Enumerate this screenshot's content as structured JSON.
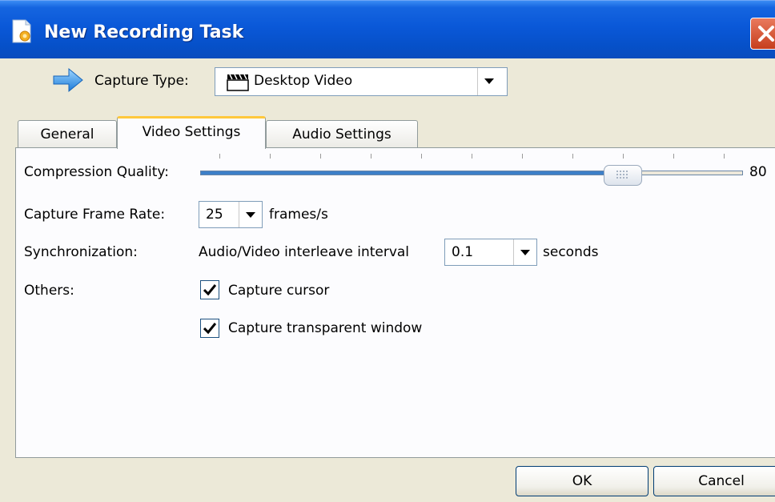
{
  "window": {
    "title": "New Recording Task",
    "app_icon": "document-new-icon",
    "close_icon": "close-icon",
    "accent_color": "#0A58D8"
  },
  "capture": {
    "label": "Capture Type:",
    "selected": "Desktop Video",
    "icon": "clapperboard-icon",
    "row_icon": "blue-arrow-right-icon"
  },
  "tabs": [
    {
      "label": "General",
      "active": false
    },
    {
      "label": "Video Settings",
      "active": true
    },
    {
      "label": "Audio Settings",
      "active": false
    }
  ],
  "video": {
    "compression": {
      "label": "Compression Quality:",
      "value": "80",
      "level": 80
    },
    "frame_rate": {
      "label": "Capture Frame Rate:",
      "value": "25",
      "unit": "frames/s"
    },
    "sync": {
      "label": "Synchronization:",
      "description": "Audio/Video interleave interval",
      "value": "0.1",
      "unit": "seconds"
    },
    "others": {
      "label": "Others:",
      "capture_cursor": {
        "label": "Capture cursor",
        "checked": true
      },
      "capture_transparent": {
        "label": "Capture transparent window",
        "checked": true
      }
    }
  },
  "buttons": {
    "ok": "OK",
    "cancel": "Cancel"
  }
}
